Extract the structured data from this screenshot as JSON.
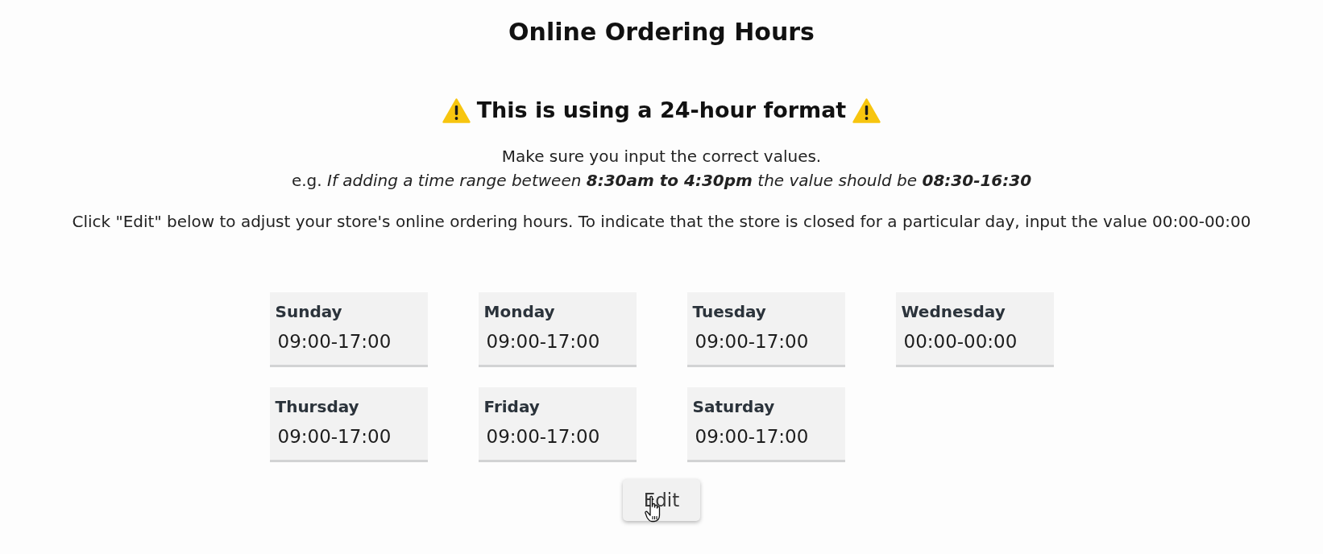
{
  "title": "Online Ordering Hours",
  "notice": {
    "heading": "This is using a 24-hour format",
    "lines": [
      "Make sure you input the correct values.",
      "e.g. *If adding a time range between* **8:30am to 4:30pm** *the value should be* **08:30-16:30**"
    ]
  },
  "help_text": "Click \"Edit\" below to adjust your store's online ordering hours. To indicate that the store is closed for a particular day, input the value 00:00-00:00",
  "days": [
    {
      "day": "Sunday",
      "hours": "09:00-17:00"
    },
    {
      "day": "Monday",
      "hours": "09:00-17:00"
    },
    {
      "day": "Tuesday",
      "hours": "09:00-17:00"
    },
    {
      "day": "Wednesday",
      "hours": "00:00-00:00"
    },
    {
      "day": "Thursday",
      "hours": "09:00-17:00"
    },
    {
      "day": "Friday",
      "hours": "09:00-17:00"
    },
    {
      "day": "Saturday",
      "hours": "09:00-17:00"
    }
  ],
  "edit_button": {
    "label": "Edit"
  }
}
